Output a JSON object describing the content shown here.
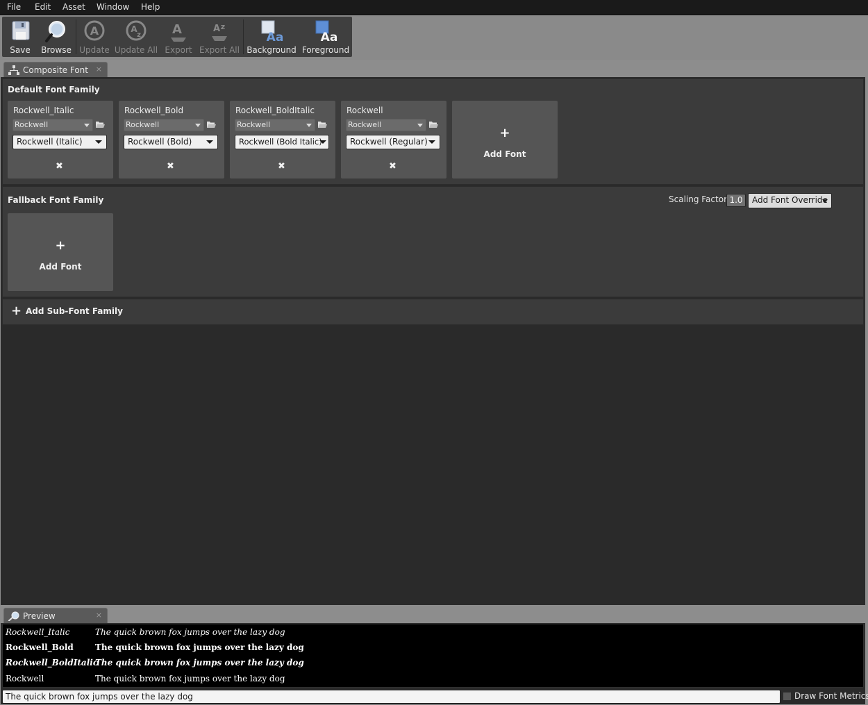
{
  "menu": [
    "File",
    "Edit",
    "Asset",
    "Window",
    "Help"
  ],
  "toolbar": {
    "save": "Save",
    "browse": "Browse",
    "update": "Update",
    "update_all": "Update All",
    "export": "Export",
    "export_all": "Export All",
    "background": "Background",
    "foreground": "Foreground"
  },
  "tabs": {
    "composite": "Composite Font",
    "preview": "Preview",
    "close_glyph": "×"
  },
  "default_family": {
    "title": "Default Font Family",
    "fonts": [
      {
        "name": "Rockwell_Italic",
        "asset": "Rockwell",
        "face": "Rockwell (Italic)"
      },
      {
        "name": "Rockwell_Bold",
        "asset": "Rockwell",
        "face": "Rockwell (Bold)"
      },
      {
        "name": "Rockwell_BoldItalic",
        "asset": "Rockwell",
        "face": "Rockwell (Bold Italic)"
      },
      {
        "name": "Rockwell",
        "asset": "Rockwell",
        "face": "Rockwell (Regular)"
      }
    ],
    "remove_glyph": "✖",
    "add_plus": "+",
    "add_label": "Add Font"
  },
  "fallback_family": {
    "title": "Fallback Font Family",
    "scaling_label": "Scaling Factor:",
    "scaling_value": "1.0",
    "override_label": "Add Font Override",
    "add_plus": "+",
    "add_label": "Add Font"
  },
  "sub_font": {
    "plus": "+",
    "label": "Add Sub-Font Family"
  },
  "preview": {
    "rows": [
      {
        "name": "Rockwell_Italic",
        "text": "The quick brown fox jumps over the lazy dog"
      },
      {
        "name": "Rockwell_Bold",
        "text": "The quick brown fox jumps over the lazy dog"
      },
      {
        "name": "Rockwell_BoldItalic",
        "text": "The quick brown fox jumps over the lazy dog"
      },
      {
        "name": "Rockwell",
        "text": "The quick brown fox jumps over the lazy dog"
      }
    ],
    "input_value": "The quick brown fox jumps over the lazy dog",
    "draw_metrics": "Draw Font Metrics"
  }
}
